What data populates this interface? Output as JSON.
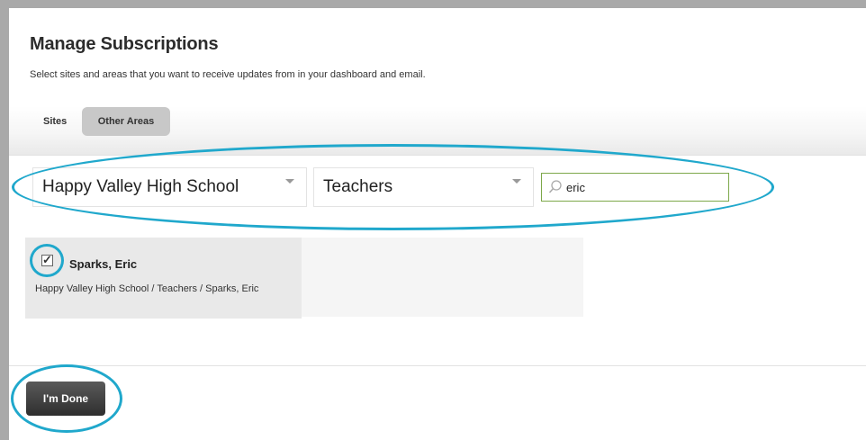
{
  "header": {
    "title": "Manage Subscriptions",
    "subtitle": "Select sites and areas that you want to receive updates from in your dashboard and email."
  },
  "tabs": [
    {
      "label": "Sites",
      "selected": false
    },
    {
      "label": "Other Areas",
      "selected": true
    }
  ],
  "filters": {
    "school": "Happy Valley High School",
    "role": "Teachers",
    "search_query": "eric"
  },
  "results": [
    {
      "name": "Sparks, Eric",
      "path": "Happy Valley High School / Teachers / Sparks, Eric",
      "checked": true
    }
  ],
  "actions": {
    "done_label": "I'm Done"
  },
  "colors": {
    "highlight_ring": "#20a8cc",
    "search_border": "#7da84a",
    "done_button": "#3a3a3a"
  }
}
